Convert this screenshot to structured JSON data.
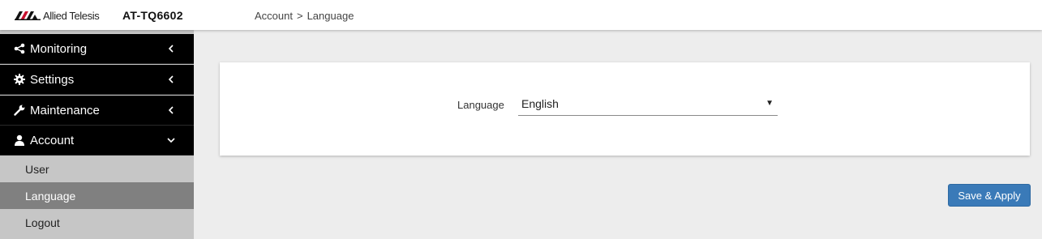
{
  "header": {
    "brand_name": "Allied Telesis",
    "model": "AT-TQ6602",
    "breadcrumb": [
      "Account",
      ">",
      "Language"
    ]
  },
  "sidebar": {
    "items": [
      {
        "label": "Monitoring",
        "icon": "share-icon",
        "chevron": "chevron-left-icon"
      },
      {
        "label": "Settings",
        "icon": "gear-icon",
        "chevron": "chevron-left-icon"
      },
      {
        "label": "Maintenance",
        "icon": "wrench-icon",
        "chevron": "chevron-left-icon"
      },
      {
        "label": "Account",
        "icon": "user-icon",
        "chevron": "chevron-down-icon"
      }
    ],
    "sub_items": [
      {
        "label": "User",
        "active": false
      },
      {
        "label": "Language",
        "active": true
      },
      {
        "label": "Logout",
        "active": false
      }
    ]
  },
  "main": {
    "language_label": "Language",
    "language_value": "English",
    "save_label": "Save & Apply"
  },
  "colors": {
    "nav_bg": "#000000",
    "active_sub_bg": "#808080",
    "button_bg": "#3a7ab8"
  }
}
